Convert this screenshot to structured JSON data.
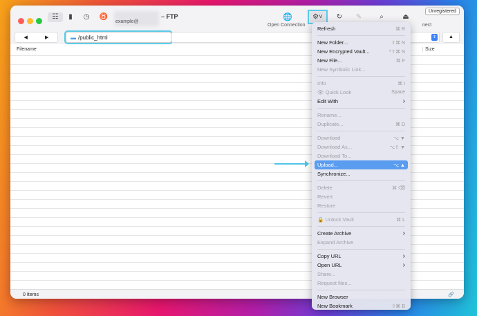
{
  "window": {
    "title": "– FTP",
    "subtitle": "example@",
    "unregistered": "Unregistered",
    "open_connection": "Open Connection",
    "disconnect_partial": "nect"
  },
  "path": "/public_html",
  "columns": {
    "filename": "Filename",
    "size": "Size"
  },
  "status": "0 Items",
  "menu": [
    {
      "label": "Refresh",
      "sc": "⌘ R"
    },
    {
      "sep": true
    },
    {
      "label": "New Folder...",
      "sc": "⇧⌘ N"
    },
    {
      "label": "New Encrypted Vault...",
      "sc": "^⇧⌘ N"
    },
    {
      "label": "New File...",
      "sc": "⌘ F"
    },
    {
      "label": "New Symbolic Link...",
      "dis": true
    },
    {
      "sep": true
    },
    {
      "label": "Info",
      "sc": "⌘ I",
      "dis": true
    },
    {
      "label": "👁  Quick Look",
      "sc": "Space",
      "dis": true
    },
    {
      "label": "Edit With",
      "sc": "›"
    },
    {
      "sep": true
    },
    {
      "label": "Rename...",
      "dis": true
    },
    {
      "label": "Duplicate...",
      "sc": "⌘ D",
      "dis": true
    },
    {
      "sep": true
    },
    {
      "label": "Download",
      "sc": "⌥ ▼",
      "dis": true
    },
    {
      "label": "Download As...",
      "sc": "⌥⇧ ▼",
      "dis": true
    },
    {
      "label": "Download To...",
      "dis": true
    },
    {
      "label": "Upload...",
      "sc": "⌥ ▲",
      "sel": true
    },
    {
      "label": "Synchronize..."
    },
    {
      "sep": true
    },
    {
      "label": "Delete",
      "sc": "⌘ ⌫",
      "dis": true
    },
    {
      "label": "Revert",
      "dis": true
    },
    {
      "label": "Restore",
      "dis": true
    },
    {
      "sep": true
    },
    {
      "label": "🔒  Unlock Vault",
      "sc": "⌘ L",
      "dis": true
    },
    {
      "sep": true
    },
    {
      "label": "Create Archive",
      "sc": "›"
    },
    {
      "label": "Expand Archive",
      "dis": true
    },
    {
      "sep": true
    },
    {
      "label": "Copy URL",
      "sc": "›"
    },
    {
      "label": "Open URL",
      "sc": "›"
    },
    {
      "label": "Share...",
      "dis": true
    },
    {
      "label": "Request files...",
      "dis": true
    },
    {
      "sep": true
    },
    {
      "label": "New Browser"
    },
    {
      "label": "New Bookmark",
      "sc": "⇧⌘ B"
    }
  ]
}
